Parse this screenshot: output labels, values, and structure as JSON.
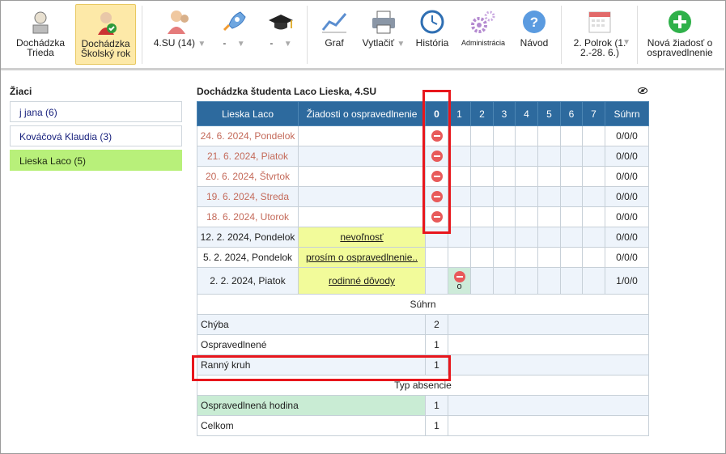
{
  "toolbar": {
    "items": [
      {
        "label": "Dochádzka\nTrieda",
        "icon": "attendance-class-icon"
      },
      {
        "label": "Dochádzka\nŠkolský rok",
        "icon": "attendance-year-icon"
      },
      {
        "label": "4.SU (14)",
        "icon": "students-icon"
      },
      {
        "label": "-",
        "icon": "rocket-icon"
      },
      {
        "label": "-",
        "icon": "graduation-cap-icon"
      },
      {
        "label": "Graf",
        "icon": "chart-icon"
      },
      {
        "label": "Vytlačiť",
        "icon": "printer-icon"
      },
      {
        "label": "História",
        "icon": "clock-icon"
      },
      {
        "label": "Administrácia",
        "icon": "gears-icon"
      },
      {
        "label": "Návod",
        "icon": "help-icon"
      },
      {
        "label": "2. Polrok (1.\n2.-28. 6.)",
        "icon": "calendar-icon"
      },
      {
        "label": "Nová žiadosť o\nospravedlnenie",
        "icon": "plus-icon"
      }
    ]
  },
  "sidebar": {
    "title": "Žiaci",
    "students": [
      {
        "label": "j jana (6)"
      },
      {
        "label": "Kováčová Klaudia (3)"
      },
      {
        "label": "Lieska Laco (5)"
      }
    ]
  },
  "main": {
    "title": "Dochádzka študenta Laco Lieska, 4.SU",
    "headers": [
      "Lieska Laco",
      "Žiadosti o ospravedlnenie",
      "0",
      "1",
      "2",
      "3",
      "4",
      "5",
      "6",
      "7",
      "Súhrn"
    ],
    "rows": [
      {
        "date": "24. 6. 2024, Pondelok",
        "request": "",
        "absent0": true,
        "absent1": false,
        "summary": "0/0/0"
      },
      {
        "date": "21. 6. 2024, Piatok",
        "request": "",
        "absent0": true,
        "absent1": false,
        "summary": "0/0/0"
      },
      {
        "date": "20. 6. 2024, Štvrtok",
        "request": "",
        "absent0": true,
        "absent1": false,
        "summary": "0/0/0"
      },
      {
        "date": "19. 6. 2024, Streda",
        "request": "",
        "absent0": true,
        "absent1": false,
        "summary": "0/0/0"
      },
      {
        "date": "18. 6. 2024, Utorok",
        "request": "",
        "absent0": true,
        "absent1": false,
        "summary": "0/0/0"
      },
      {
        "date": "12. 2. 2024, Pondelok",
        "request": "nevoľnosť",
        "absent0": false,
        "absent1": false,
        "summary": "0/0/0"
      },
      {
        "date": "5. 2. 2024, Pondelok",
        "request": "prosím o ospravedlnenie..",
        "absent0": false,
        "absent1": false,
        "summary": "0/0/0"
      },
      {
        "date": "2. 2. 2024, Piatok",
        "request": "rodinné dôvody",
        "absent0": false,
        "absent1": true,
        "absent1_code": "o",
        "summary": "1/0/0"
      }
    ],
    "summary_section": "Súhrn",
    "summary_rows": [
      {
        "label": "Chýba",
        "value": "2"
      },
      {
        "label": "Ospravedlnené",
        "value": "1"
      },
      {
        "label": "Ranný kruh",
        "value": "1"
      }
    ],
    "type_section": "Typ absencie",
    "type_rows": [
      {
        "label": "Ospravedlnená hodina",
        "value": "1"
      },
      {
        "label": "Celkom",
        "value": "1"
      }
    ]
  },
  "colors": {
    "header": "#2d6a9e",
    "highlight": "#e8161c",
    "selected_student": "#b8f07a",
    "justification": "#f2fb9a",
    "absence": "#e85a5a"
  }
}
